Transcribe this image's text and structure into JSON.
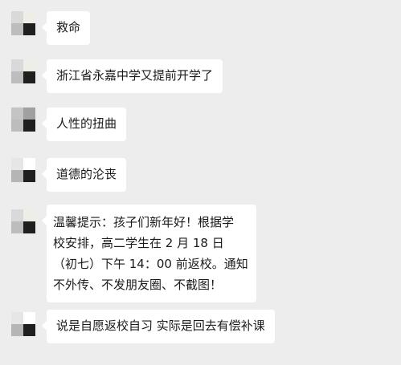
{
  "messages": [
    {
      "text": "救命",
      "avatar": [
        "#d9d9d9",
        "#eeeee6",
        "#bdbdbd",
        "#1f1f1f"
      ]
    },
    {
      "text": "浙江省永嘉中学又提前开学了",
      "avatar": [
        "#d9d9d9",
        "#eeeee6",
        "#bdbdbd",
        "#1f1f1f"
      ]
    },
    {
      "text": "人性的扭曲",
      "avatar": [
        "#c4c4c4",
        "#a0a0a0",
        "#bdbdbd",
        "#1f1f1f"
      ]
    },
    {
      "text": "道德的沦丧",
      "avatar": [
        "#e6e6e6",
        "#ffffff",
        "#b5b5b5",
        "#1f1f1f"
      ]
    },
    {
      "lines": [
        "温馨提示：孩子们新年好！根据学",
        "校安排，高二学生在 2 月 18 日",
        "（初七）下午 14：00 前返校。通知",
        "不外传、不发朋友圈、不截图！"
      ],
      "avatar": [
        "#d9d9d9",
        "#eeeee6",
        "#bdbdbd",
        "#1f1f1f"
      ]
    },
    {
      "text": "说是自愿返校自习 实际是回去有偿补课",
      "avatar": [
        "#e6e6e6",
        "#ffffff",
        "#b5b5b5",
        "#1f1f1f"
      ]
    }
  ],
  "colors": {
    "background": "#ededed",
    "bubble": "#ffffff",
    "text": "#1a1a1a"
  }
}
